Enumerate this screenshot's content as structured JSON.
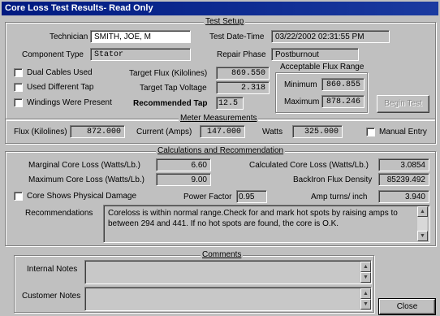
{
  "window": {
    "title": "Core Loss Test Results- Read Only"
  },
  "test_setup": {
    "legend": "Test Setup",
    "technician_label": "Technician",
    "technician": "SMITH, JOE, M",
    "test_datetime_label": "Test Date-Time",
    "test_datetime": "03/22/2002 02:31:55 PM",
    "component_type_label": "Component Type",
    "component_type": "Stator",
    "repair_phase_label": "Repair Phase",
    "repair_phase": "Postburnout",
    "dual_cables_label": "Dual Cables Used",
    "used_diff_tap_label": "Used Different Tap",
    "windings_label": "Windings Were Present",
    "target_flux_label": "Target Flux (Kilolines)",
    "target_flux": "869.550",
    "target_tap_voltage_label": "Target Tap Voltage",
    "target_tap_voltage": "2.318",
    "recommended_tap_label": "Recommended Tap",
    "recommended_tap": "12.5",
    "flux_range_label": "Acceptable Flux Range",
    "minimum_label": "Minimum",
    "minimum": "860.855",
    "maximum_label": "Maximum",
    "maximum": "878.246",
    "begin_test_label": "Begin Test"
  },
  "meter": {
    "legend": "Meter Measurements",
    "flux_label": "Flux (Kilolines)",
    "flux": "872.000",
    "current_label": "Current (Amps)",
    "current": "147.000",
    "watts_label": "Watts",
    "watts": "325.000",
    "manual_entry_label": "Manual Entry"
  },
  "calc": {
    "legend": "Calculations and Recommendation",
    "marginal_label": "Marginal Core Loss (Watts/Lb.)",
    "marginal": "6.60",
    "maximum_loss_label": "Maximum Core Loss (Watts/Lb.)",
    "maximum_loss": "9.00",
    "calculated_label": "Calculated Core Loss (Watts/Lb.)",
    "calculated": "3.0854",
    "backiron_label": "BackIron Flux Density",
    "backiron": "85239.492",
    "physical_damage_label": "Core Shows Physical Damage",
    "power_factor_label": "Power Factor",
    "power_factor": "0.95",
    "amp_turns_label": "Amp turns/ inch",
    "amp_turns": "3.940",
    "recommendations_label": "Recommendations",
    "recommendations_text": "Coreloss is within normal range.Check for and mark hot spots by raising amps to between 294 and 441.  If no hot spots are found, the core is O.K."
  },
  "comments": {
    "legend": "Comments",
    "internal_label": "Internal Notes",
    "internal_value": "",
    "customer_label": "Customer Notes",
    "customer_value": ""
  },
  "close_label": "Close"
}
